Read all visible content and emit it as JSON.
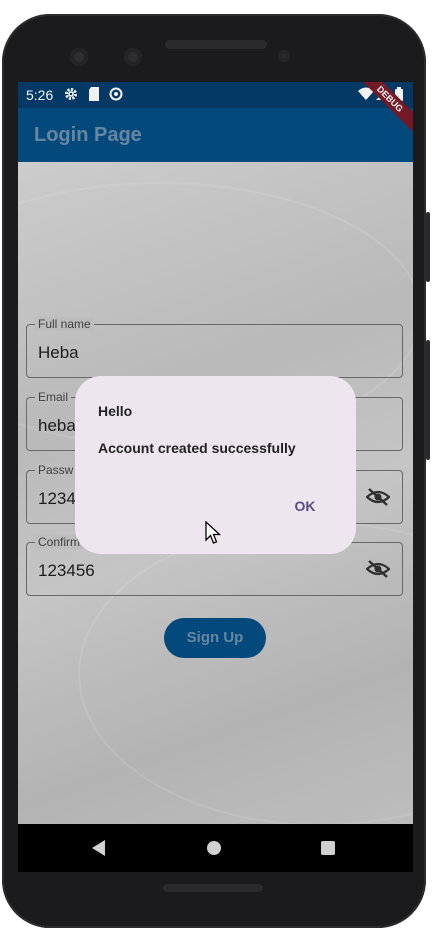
{
  "status_bar": {
    "time": "5:26",
    "left_icons": [
      "gear-icon",
      "sim-card-icon",
      "sync-icon"
    ],
    "right_icons": [
      "wifi-icon",
      "signal-icon",
      "battery-icon"
    ],
    "debug_banner": "DEBUG"
  },
  "app_bar": {
    "title": "Login Page"
  },
  "form": {
    "full_name": {
      "label": "Full name",
      "value": "Heba"
    },
    "email": {
      "label": "Email",
      "value": "heba"
    },
    "password": {
      "label": "Passw",
      "value": "1234"
    },
    "confirm_password": {
      "label": "Confirm",
      "value": "123456"
    },
    "signup_label": "Sign Up"
  },
  "dialog": {
    "title": "Hello",
    "content": "Account created successfully",
    "ok_label": "OK"
  },
  "colors": {
    "app_bar": "#054d82",
    "status_bar": "#043d6a",
    "dialog_bg": "#ede6ee",
    "dialog_action": "#5a4b82"
  }
}
